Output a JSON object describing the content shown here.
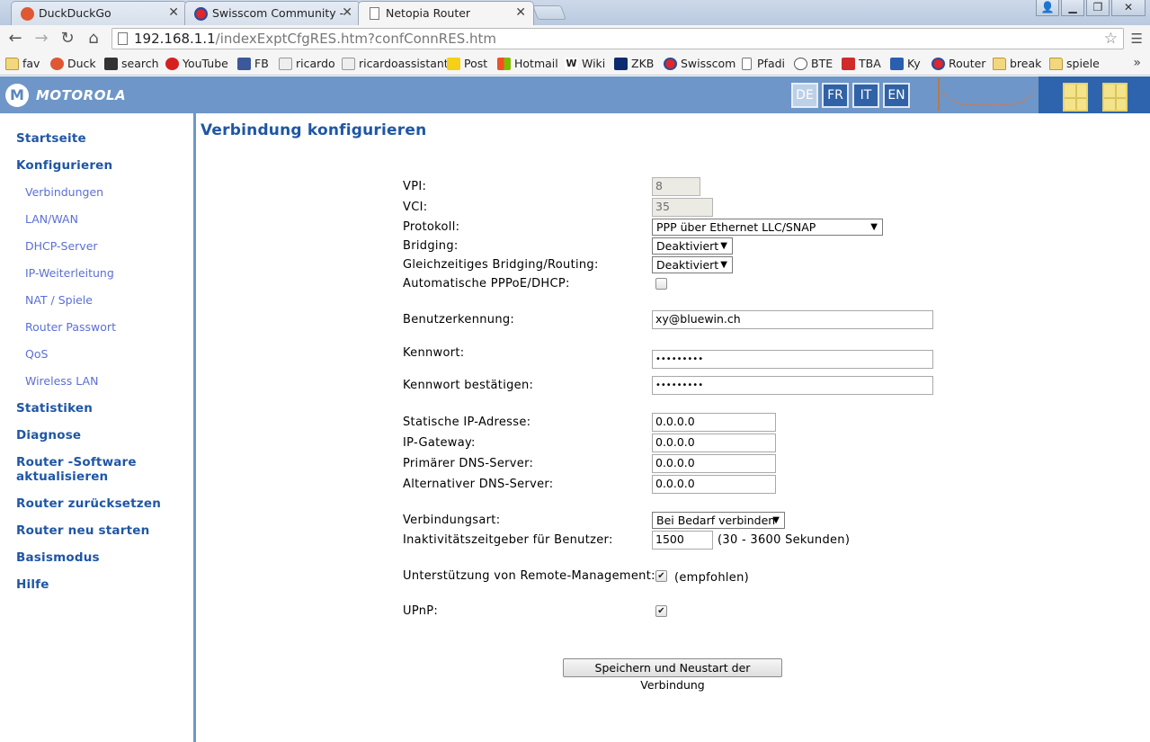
{
  "browser": {
    "tabs": [
      {
        "label": "DuckDuckGo",
        "icon": "duckduckgo-icon"
      },
      {
        "label": "Swisscom Community - wl",
        "icon": "swisscom-icon"
      },
      {
        "label": "Netopia Router",
        "icon": "page-icon"
      }
    ],
    "address": {
      "host": "192.168.1.1",
      "path": "/indexExptCfgRES.htm?confConnRES.htm"
    },
    "bookmarks": [
      "fav",
      "Duck",
      "search",
      "YouTube",
      "FB",
      "ricardo",
      "ricardoassistant",
      "Post",
      "Hotmail",
      "Wiki",
      "ZKB",
      "Swisscom",
      "Pfadi",
      "BTE",
      "TBA",
      "Ky",
      "Router",
      "break",
      "spiele"
    ]
  },
  "header": {
    "brand": "MOTOROLA",
    "languages": [
      "DE",
      "FR",
      "IT",
      "EN"
    ],
    "current_language": "DE"
  },
  "sidebar": {
    "main_items": [
      "Startseite",
      "Konfigurieren",
      "Statistiken",
      "Diagnose",
      "Router -Software",
      "aktualisieren",
      "Router zurücksetzen",
      "Router neu starten",
      "Basismodus",
      "Hilfe"
    ],
    "sub_items": [
      "Verbindungen",
      "LAN/WAN",
      "DHCP-Server",
      "IP-Weiterleitung",
      "NAT / Spiele",
      "Router Passwort",
      "QoS",
      "Wireless LAN"
    ]
  },
  "page": {
    "title": "Verbindung konfigurieren",
    "fields": {
      "vpi": {
        "label": "VPI:",
        "value": "8"
      },
      "vci": {
        "label": "VCI:",
        "value": "35"
      },
      "protokoll": {
        "label": "Protokoll:",
        "value": "PPP über Ethernet LLC/SNAP"
      },
      "bridging": {
        "label": "Bridging:",
        "value": "Deaktiviert"
      },
      "bridging_routing": {
        "label": "Gleichzeitiges Bridging/Routing:",
        "value": "Deaktiviert"
      },
      "auto_pppoe": {
        "label": "Automatische PPPoE/DHCP:",
        "checked": false
      },
      "benutzer": {
        "label": "Benutzerkennung:",
        "value": "xy@bluewin.ch"
      },
      "kennwort": {
        "label": "Kennwort:",
        "value": "•••••••••"
      },
      "kennwort2": {
        "label": "Kennwort bestätigen:",
        "value": "•••••••••"
      },
      "static_ip": {
        "label": "Statische IP-Adresse:",
        "value": "0.0.0.0"
      },
      "gateway": {
        "label": "IP-Gateway:",
        "value": "0.0.0.0"
      },
      "dns1": {
        "label": "Primärer DNS-Server:",
        "value": "0.0.0.0"
      },
      "dns2": {
        "label": "Alternativer DNS-Server:",
        "value": "0.0.0.0"
      },
      "verbindungsart": {
        "label": "Verbindungsart:",
        "value": "Bei Bedarf verbinden"
      },
      "timeout": {
        "label": "Inaktivitätszeitgeber für Benutzer:",
        "value": "1500",
        "hint": "(30 - 3600 Sekunden)"
      },
      "remote_mgmt": {
        "label": "Unterstützung von Remote-Management:",
        "checked": true,
        "hint": "(empfohlen)"
      },
      "upnp": {
        "label": "UPnP:",
        "checked": true
      }
    },
    "save_button": "Speichern und Neustart der Verbindung"
  }
}
